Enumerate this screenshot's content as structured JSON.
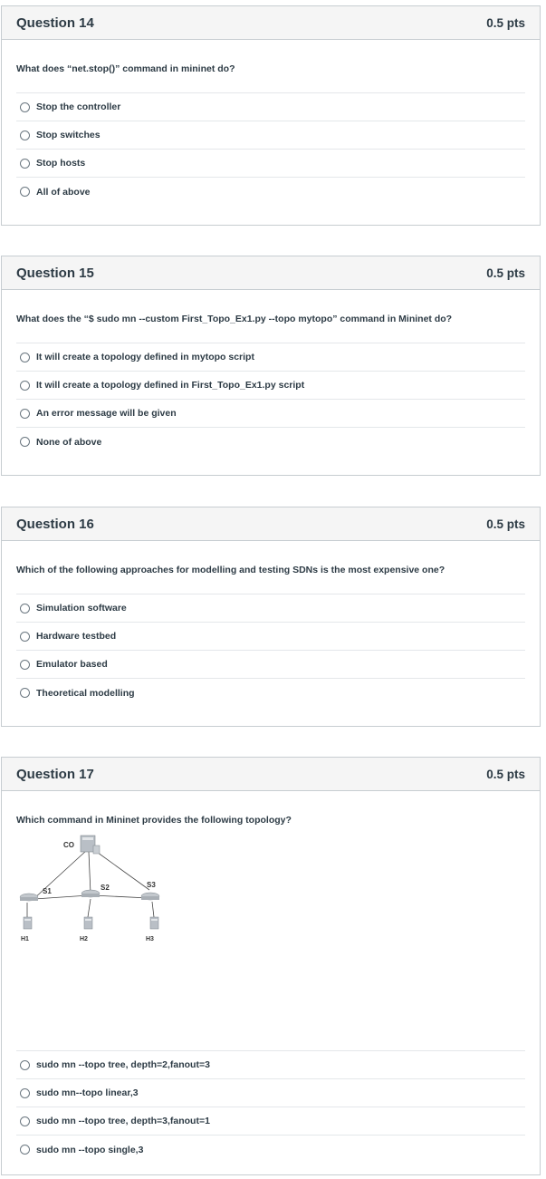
{
  "questions": [
    {
      "title": "Question 14",
      "points": "0.5 pts",
      "text": "What does “net.stop()” command in mininet do?",
      "answers": [
        "Stop the controller",
        "Stop switches",
        "Stop hosts",
        "All of above"
      ]
    },
    {
      "title": "Question 15",
      "points": "0.5 pts",
      "text": "What does the “$ sudo mn --custom First_Topo_Ex1.py  --topo mytopo” command in Mininet do?",
      "answers": [
        "It will create a topology defined in mytopo script",
        "It will create a topology defined in First_Topo_Ex1.py script",
        "An error message will be given",
        "None of above"
      ]
    },
    {
      "title": "Question 16",
      "points": "0.5 pts",
      "text": "Which of the following approaches for modelling and testing SDNs is the most expensive one?",
      "answers": [
        "Simulation software",
        "Hardware testbed",
        "Emulator based",
        "Theoretical modelling"
      ]
    },
    {
      "title": "Question 17",
      "points": "0.5 pts",
      "text": "Which command in Mininet provides the following topology?",
      "figure_labels": {
        "controller": "CO",
        "s1": "S1",
        "s2": "S2",
        "s3": "S3",
        "h1": "H1",
        "h2": "H2",
        "h3": "H3"
      },
      "answers": [
        "sudo mn --topo tree, depth=2,fanout=3",
        "sudo mn--topo linear,3",
        "sudo mn --topo tree, depth=3,fanout=1",
        "sudo mn --topo single,3"
      ]
    }
  ]
}
